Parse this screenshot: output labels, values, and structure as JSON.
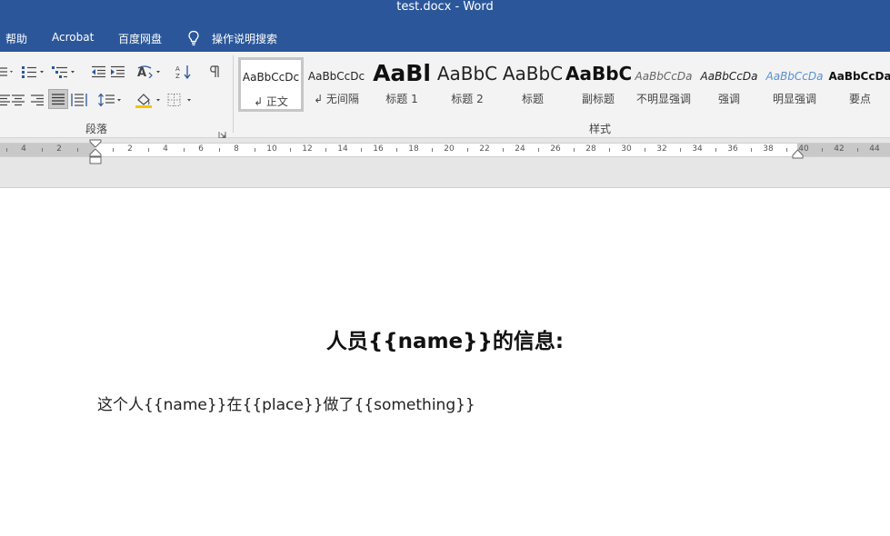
{
  "window": {
    "title": "test.docx  -  Word"
  },
  "menu": {
    "help": "帮助",
    "acrobat": "Acrobat",
    "baidu": "百度网盘",
    "search": "操作说明搜索"
  },
  "colors": {
    "title_bar": "#2b579a",
    "ribbon": "#f3f3f3",
    "heading_text": "#111111"
  },
  "ribbon": {
    "paragraph_group_label": "段落",
    "styles_group_label": "样式",
    "styles": [
      {
        "sample": "AaBbCcDc",
        "name": "↲ 正文",
        "selected": true
      },
      {
        "sample": "AaBbCcDc",
        "name": "↲ 无间隔"
      },
      {
        "sample": "AaBl",
        "name": "标题 1"
      },
      {
        "sample": "AaBbC",
        "name": "标题 2"
      },
      {
        "sample": "AaBbC",
        "name": "标题"
      },
      {
        "sample": "AaBbC",
        "name": "副标题"
      },
      {
        "sample": "AaBbCcDa",
        "name": "不明显强调"
      },
      {
        "sample": "AaBbCcDa",
        "name": "强调"
      },
      {
        "sample": "AaBbCcDa",
        "name": "明显强调"
      },
      {
        "sample": "AaBbCcDa",
        "name": "要点"
      }
    ]
  },
  "ruler": {
    "left_labels": [
      "4",
      "2"
    ],
    "right_labels": [
      "2",
      "4",
      "6",
      "8",
      "10",
      "12",
      "14",
      "16",
      "18",
      "20",
      "22",
      "24",
      "26",
      "28",
      "30",
      "32",
      "34",
      "36",
      "38",
      "40",
      "42",
      "44"
    ]
  },
  "document": {
    "heading": "人员{{name}}的信息:",
    "paragraph": "这个人{{name}}在{{place}}做了{{something}}"
  }
}
